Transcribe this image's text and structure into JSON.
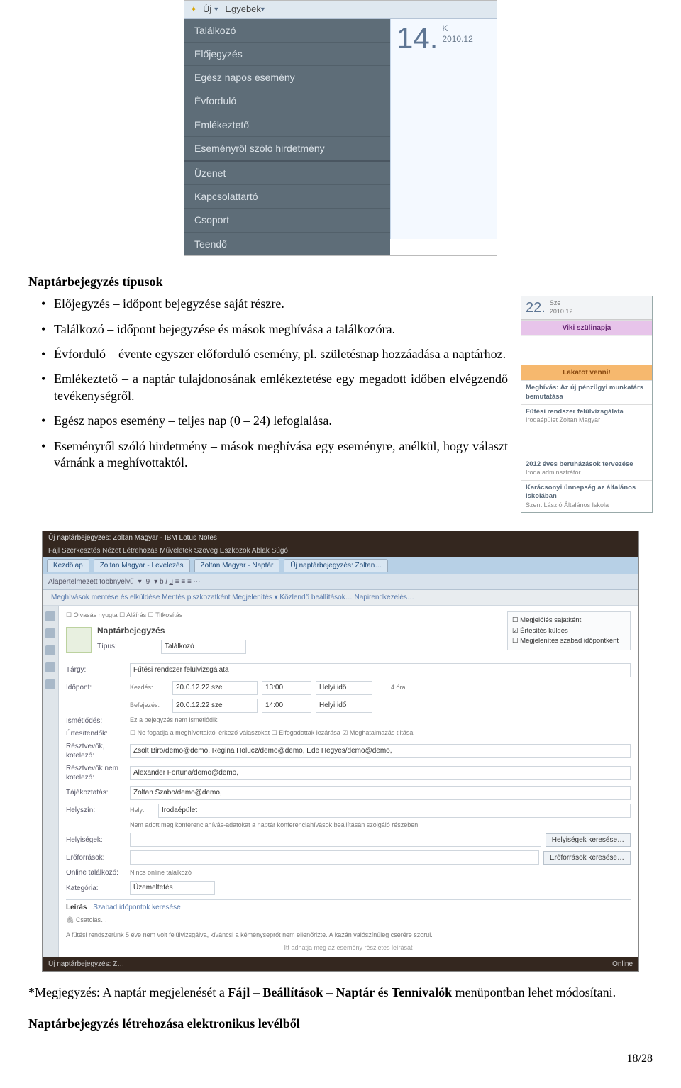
{
  "shot1": {
    "uj_label": "Új",
    "egyebek_label": "Egyebek",
    "menu_items_a": [
      "Találkozó",
      "Előjegyzés",
      "Egész napos esemény",
      "Évforduló",
      "Emlékeztető",
      "Eseményről szóló hirdetmény"
    ],
    "menu_items_b": [
      "Üzenet",
      "Kapcsolattartó",
      "Csoport",
      "Teendő"
    ],
    "side_num": "14.",
    "side_day": "K",
    "side_date": "2010.12"
  },
  "doc": {
    "title1": "Naptárbejegyzés típusok",
    "bullets": [
      "Előjegyzés – időpont bejegyzése saját részre.",
      "Találkozó – időpont bejegyzése és mások meghívása a találkozóra.",
      "Évforduló – évente egyszer előforduló esemény, pl. születésnap hozzáadása a naptárhoz.",
      "Emlékeztető – a naptár tulajdonosának emlékeztetése egy megadott időben elvégzendő tevékenységről.",
      "Egész napos esemény – teljes nap (0 – 24) lefoglalása.",
      "Eseményről szóló hirdetmény – mások meghívása egy eseményre, anélkül, hogy választ várnánk a meghívottaktól."
    ],
    "note_pre": "*Megjegyzés: A naptár megjelenését a ",
    "note_bold": "Fájl – Beállítások – Naptár és Tennivalók",
    "note_post": " menüpontban lehet módosítani.",
    "title2": "Naptárbejegyzés létrehozása elektronikus levélből",
    "pagenum": "18/28"
  },
  "sidebar": {
    "num": "22.",
    "day": "Sze",
    "date": "2010.12",
    "ev_pink": "Viki szülinapja",
    "ev_orange": "Lakatot venni!",
    "ev1_t": "Meghívás: Az új pénzügyi munkatárs bemutatása",
    "ev2_t": "Fűtési rendszer felülvizsgálata",
    "ev2_s": "Irodaépület\nZoltan Magyar",
    "ev3_t": "2012 éves beruházások tervezése",
    "ev3_s": "Iroda\nadminsztrátor",
    "ev4_t": "Karácsonyi ünnepség az általános iskolában",
    "ev4_s": "Szent László Általános Iskola"
  },
  "form": {
    "winTitle": "Új naptárbejegyzés: Zoltan Magyar - IBM Lotus Notes",
    "menubar": "Fájl  Szerkesztés  Nézet  Létrehozás  Műveletek  Szöveg  Eszközök  Ablak  Súgó",
    "tab1": "Kezdőlap",
    "tab2": "Zoltan Magyar - Levelezés",
    "tab3": "Zoltan Magyar - Naptár",
    "tab4": "Új naptárbejegyzés: Zoltan…",
    "font": "Alapértelmezett többnyelvű",
    "fontsize": "9",
    "bread": "Meghívások mentése és elküldése   Mentés piszkozatként   Megjelenítés ▾   Közlendő beállítások…   Napirendkezelés…",
    "hdr": "Naptárbejegyzés",
    "type_lab": "Típus:",
    "type_val": "Találkozó",
    "opt1": "Megjelölés sajátként",
    "opt2": "Értesítés küldés",
    "opt3": "Megjelenítés szabad időpontként",
    "chk_row": "☐ Olvasás nyugta   ☐ Aláírás   ☐ Titkosítás",
    "subj_lab": "Tárgy:",
    "subj_val": "Fűtési rendszer felülvizsgálata",
    "ido_lab": "Időpont:",
    "kezd": "Kezdés:",
    "bef": "Befejezés:",
    "d1": "20.0.12.22 sze",
    "t1": "13:00",
    "t2": "14:00",
    "tz": "Helyi idő",
    "dur": "4 óra",
    "ism_lab": "Ismétlődés:",
    "ism_val": "Ez a bejegyzés nem ismétlődik",
    "ert_lab": "Értesítendők:",
    "chk_line": "☐ Ne fogadja a meghívottaktól érkező válaszokat   ☐ Elfogadottak lezárása   ☑ Meghatalmazás tiltása",
    "resz_lab": "Résztvevők,\nkötelező:",
    "resz_val": "Zsolt Biro/demo@demo, Regina Holucz/demo@demo, Ede Hegyes/demo@demo,",
    "reszn_lab": "Résztvevők nem\nkötelező:",
    "reszn_val": "Alexander Fortuna/demo@demo,",
    "taj_lab": "Tájékoztatás:",
    "taj_val": "Zoltan Szabo/demo@demo,",
    "hely_lab": "Helyszín:",
    "hely_val_lab": "Hely:",
    "hely_val": "Irodaépület",
    "hely_note": "Nem adott meg konferenciahívás-adatokat a naptár konferenciahívások beállításán szolgáló részében.",
    "btn_hely": "Helyiségek keresése…",
    "eroforr_lab": "Erőforrások:",
    "btn_ero": "Erőforrások keresése…",
    "online_lab": "Online találkozó:",
    "online_val": "Nincs online találkozó",
    "kat_lab": "Kategória:",
    "kat_val": "Üzemeltetés",
    "leiras_lab": "Leírás",
    "szabad": "Szabad időpontok keresése",
    "csat": "Csatolás…",
    "desc": "A fűtési rendszerünk 5 éve nem volt felülvizsgálva, kíváncsi a kéményseprőt nem ellenőrizte. A kazán valószínűleg cserére szorul.",
    "hint": "Itt adhatja meg az esemény részletes leírását",
    "status_tab": "Új naptárbejegyzés: Z…",
    "status_right": "Online"
  }
}
